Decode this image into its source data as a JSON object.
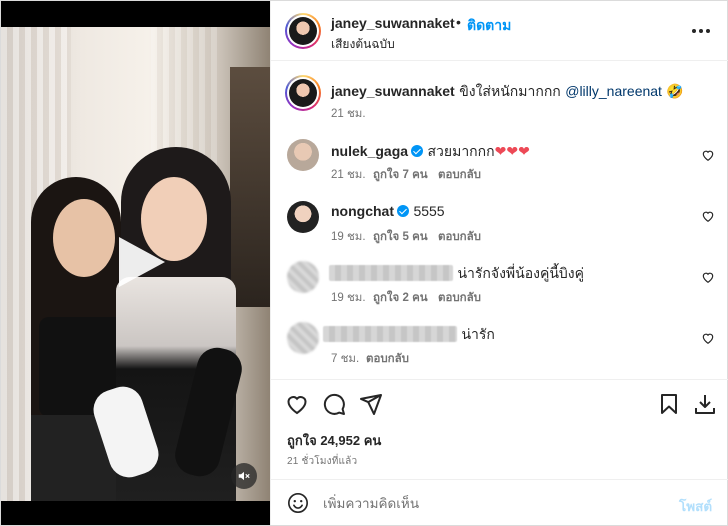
{
  "post_header": {
    "username": "janey_suwannaket",
    "dot": "•",
    "follow_label": "ติดตาม",
    "audio_label": "เสียงต้นฉบับ"
  },
  "caption": {
    "username": "janey_suwannaket",
    "text": "ขิงใส่หนักมากกก",
    "mention": "@lilly_nareenat",
    "emoji": "🤣",
    "time": "21 ชม."
  },
  "comments": [
    {
      "username": "nulek_gaga",
      "verified": true,
      "text": "สวยมากกก",
      "hearts": "❤❤❤",
      "time": "21 ชม.",
      "likes": "ถูกใจ 7 คน",
      "reply": "ตอบกลับ"
    },
    {
      "username": "nongchat",
      "verified": true,
      "text": "5555",
      "time": "19 ชม.",
      "likes": "ถูกใจ 5 คน",
      "reply": "ตอบกลับ"
    },
    {
      "username_hidden": true,
      "text": "น่ารักจังพี่น้องคู่นี้บิงคู่",
      "time": "19 ชม.",
      "likes": "ถูกใจ 2 คน",
      "reply": "ตอบกลับ"
    },
    {
      "username_hidden": true,
      "text": "น่ารัก",
      "time": "7 ชม.",
      "reply": "ตอบกลับ"
    }
  ],
  "actions": {
    "likes_text": "ถูกใจ 24,952 คน",
    "posted_time": "21 ชั่วโมงที่แล้ว"
  },
  "add_comment": {
    "placeholder": "เพิ่มความคิดเห็น",
    "post_label": "โพสต์"
  },
  "colors": {
    "accent_blue": "#0095f6",
    "mention_blue": "#00376b",
    "muted_text": "#737373",
    "disabled_post": "#b2dffc",
    "heart_red": "#ed4956"
  },
  "icons": [
    "more-options-icon",
    "verified-icon",
    "like-heart-icon",
    "comment-icon",
    "share-icon",
    "save-bookmark-icon",
    "download-icon",
    "emoji-icon",
    "play-icon",
    "mute-icon"
  ]
}
